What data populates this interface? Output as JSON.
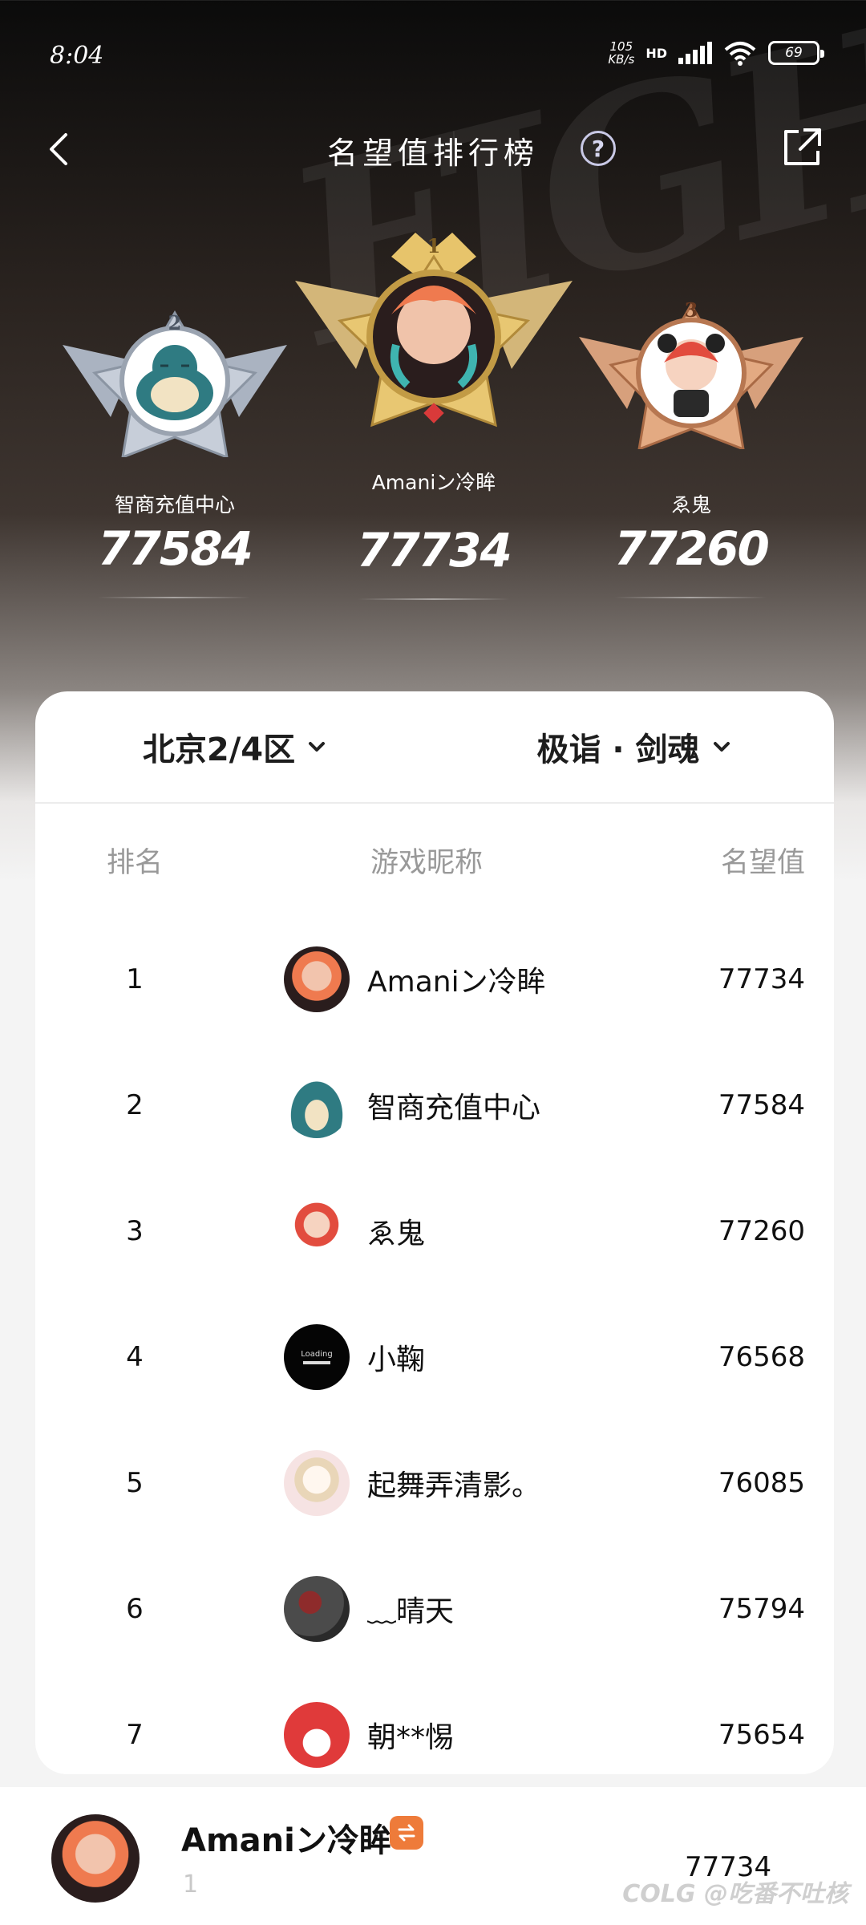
{
  "status_bar": {
    "time": "8:04",
    "net_speed_value": "105",
    "net_speed_unit": "KB/s",
    "network_type": "HD",
    "battery": "69"
  },
  "header": {
    "title": "名望值排行榜",
    "help_label": "?"
  },
  "podium": [
    {
      "rank": "1",
      "name": "Amaniン冷眸",
      "score": "77734",
      "medal_color": "#e0b85a"
    },
    {
      "rank": "2",
      "name": "智商充值中心",
      "score": "77584",
      "medal_color": "#b9c2cf"
    },
    {
      "rank": "3",
      "name": "ゑ鬼",
      "score": "77260",
      "medal_color": "#d9946d"
    }
  ],
  "filters": {
    "server": "北京2/4区",
    "profession": "极诣 · 剑魂"
  },
  "table": {
    "headers": {
      "rank": "排名",
      "name": "游戏昵称",
      "score": "名望值"
    },
    "rows": [
      {
        "rank": "1",
        "name": "Amaniン冷眸",
        "score": "77734",
        "avatar": "anime-girl-avatar"
      },
      {
        "rank": "2",
        "name": "智商充值中心",
        "score": "77584",
        "avatar": "snorlax-avatar"
      },
      {
        "rank": "3",
        "name": "ゑ鬼",
        "score": "77260",
        "avatar": "panda-girl-avatar"
      },
      {
        "rank": "4",
        "name": "小鞠",
        "score": "76568",
        "avatar": "loading-avatar",
        "avatar_text": "Loading"
      },
      {
        "rank": "5",
        "name": "起舞弄清影。",
        "score": "76085",
        "avatar": "chibi-avatar"
      },
      {
        "rank": "6",
        "name": "﹏晴天",
        "score": "75794",
        "avatar": "dark-red-avatar"
      },
      {
        "rank": "7",
        "name": "朝**惕",
        "score": "75654",
        "avatar": "red-hood-avatar"
      }
    ]
  },
  "me": {
    "name": "Amaniン冷眸",
    "rank": "1",
    "score": "77734"
  },
  "watermark": "COLG @吃番不吐核",
  "colors": {
    "accent_orange": "#ee7b3a",
    "help_ring": "#c9c9e6"
  }
}
